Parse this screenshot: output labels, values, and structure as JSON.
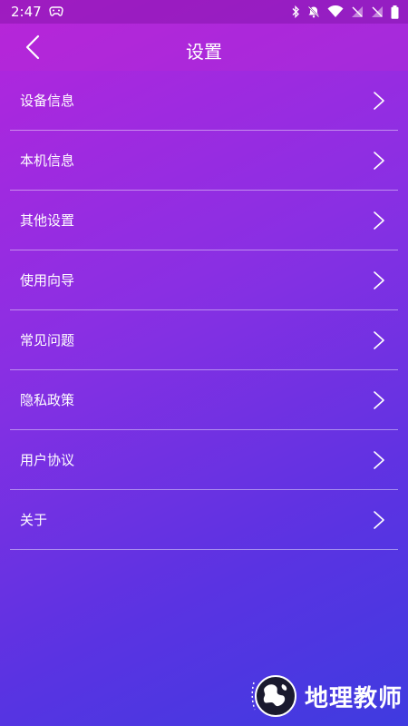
{
  "status_bar": {
    "time": "2:47",
    "icons": [
      "game-controller-icon",
      "bluetooth-icon",
      "mute-bell-icon",
      "wifi-icon",
      "no-signal-icon",
      "no-signal-icon",
      "battery-icon"
    ]
  },
  "header": {
    "title": "设置",
    "back_icon": "chevron-left-icon"
  },
  "menu": {
    "items": [
      {
        "label": "设备信息"
      },
      {
        "label": "本机信息"
      },
      {
        "label": "其他设置"
      },
      {
        "label": "使用向导"
      },
      {
        "label": "常见问题"
      },
      {
        "label": "隐私政策"
      },
      {
        "label": "用户协议"
      },
      {
        "label": "关于"
      }
    ]
  },
  "watermark": {
    "text": "地理教师"
  },
  "colors": {
    "gradient_start": "#b525dc",
    "gradient_end": "#3f3be0",
    "text": "#ffffff"
  }
}
